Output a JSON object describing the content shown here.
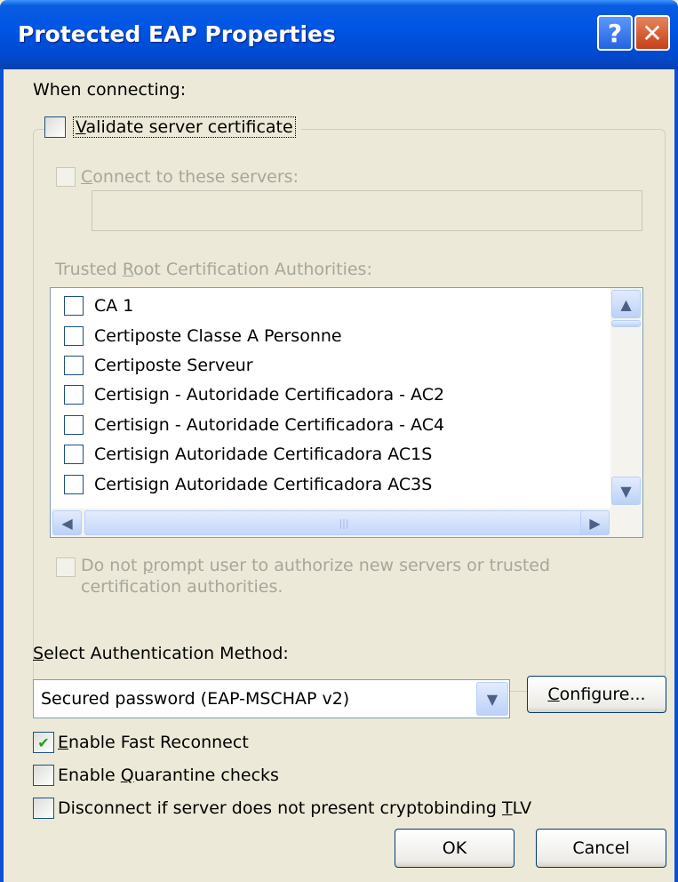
{
  "window": {
    "title": "Protected EAP Properties",
    "help_button": "?",
    "close_button": "✕"
  },
  "when_connecting_label": "When connecting:",
  "validate_server_cert": {
    "label_prefix": "",
    "label_ul": "V",
    "label_rest": "alidate server certificate",
    "checked": false
  },
  "connect_to_servers": {
    "label_prefix": "",
    "label_ul": "C",
    "label_rest": "onnect to these servers:",
    "checked": false,
    "value": ""
  },
  "trusted_root_label": {
    "prefix": "Trusted ",
    "ul": "R",
    "rest": "oot Certification Authorities:"
  },
  "ca_list": [
    "CA 1",
    "Certiposte Classe A Personne",
    "Certiposte Serveur",
    "Certisign - Autoridade Certificadora - AC2",
    "Certisign - Autoridade Certificadora - AC4",
    "Certisign Autoridade Certificadora AC1S",
    "Certisign Autoridade Certificadora AC3S"
  ],
  "scroll": {
    "up": "▲",
    "down": "▼",
    "left": "◀",
    "right": "▶",
    "grip": "|||"
  },
  "do_not_prompt": {
    "line1_prefix": "Do not ",
    "line1_ul": "p",
    "line1_rest": "rompt user to authorize new servers or trusted",
    "line2": "certification authorities.",
    "checked": false
  },
  "select_auth_label": {
    "ul": "S",
    "rest": "elect Authentication Method:"
  },
  "auth_method": {
    "selected": "Secured password (EAP-MSCHAP v2)",
    "arrow": "▼"
  },
  "configure_button": {
    "ul": "C",
    "rest": "onfigure..."
  },
  "options": [
    {
      "ul": "E",
      "rest": "nable Fast Reconnect",
      "prefix": "",
      "checked": true
    },
    {
      "prefix": "Enable ",
      "ul": "Q",
      "rest": "uarantine checks",
      "checked": false
    },
    {
      "prefix": "Disconnect if server does not present cryptobinding ",
      "ul": "T",
      "rest": "LV",
      "checked": false
    }
  ],
  "ok_button": "OK",
  "cancel_button": "Cancel",
  "checkmark": "✔"
}
